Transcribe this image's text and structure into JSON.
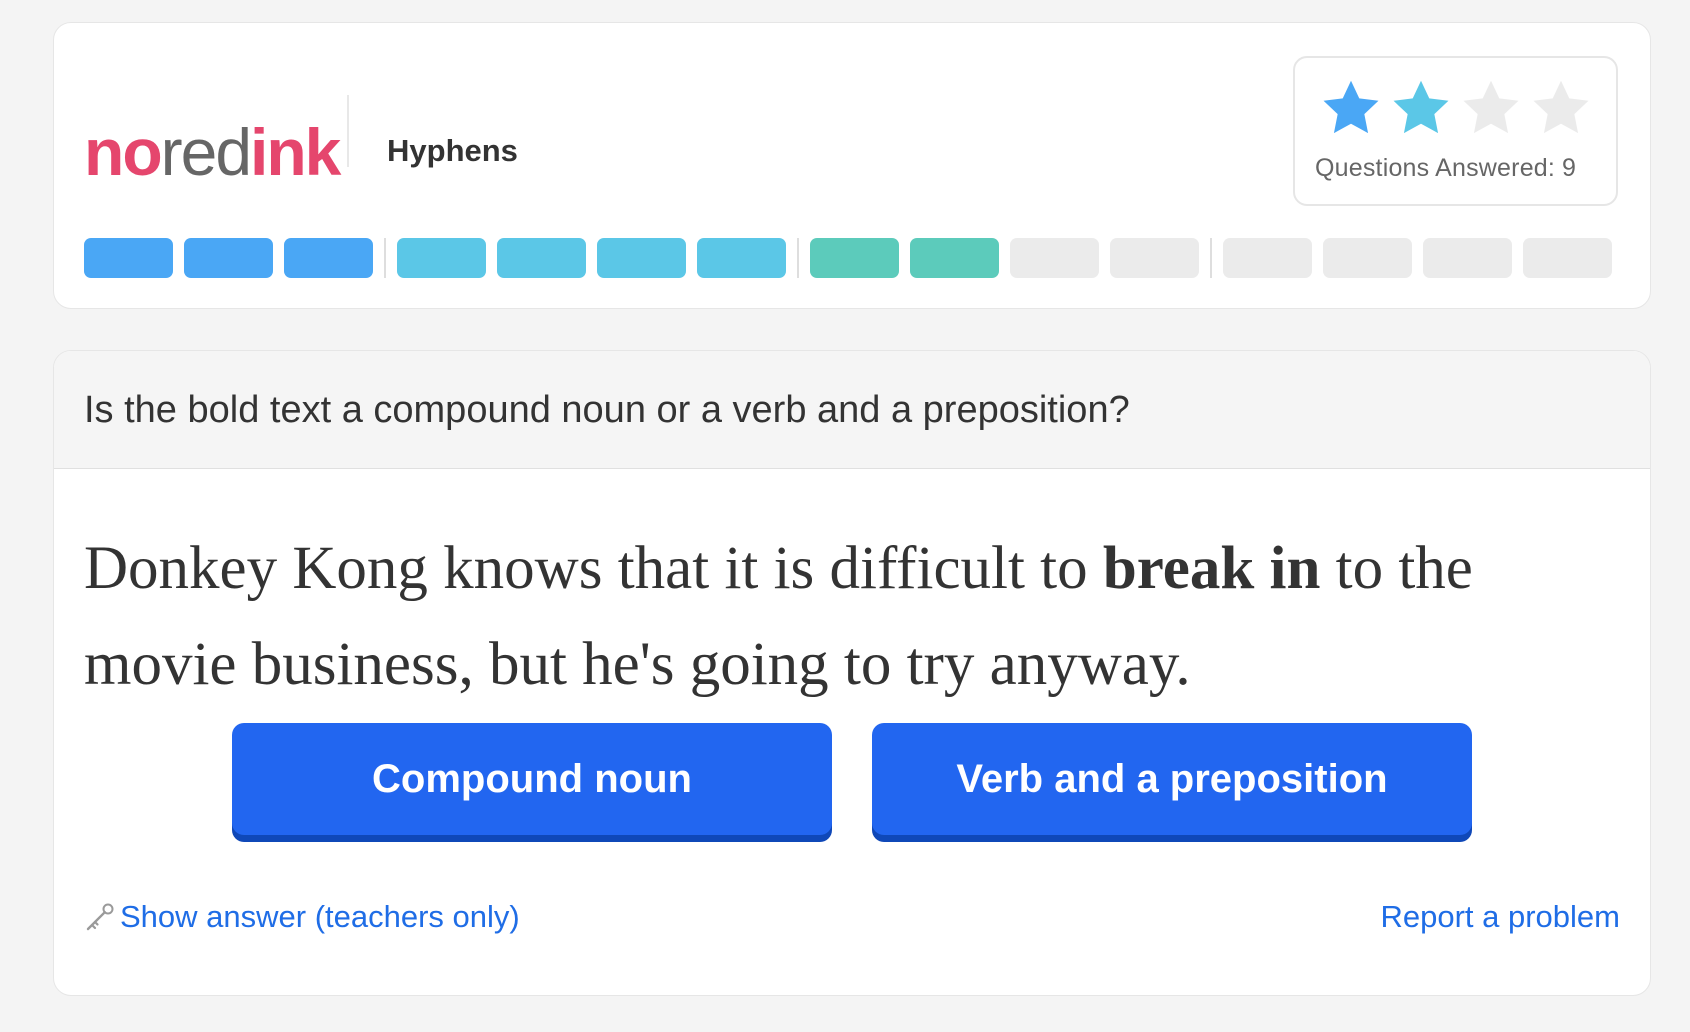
{
  "header": {
    "logo": {
      "part1": "no",
      "part2": "red",
      "part3": "ink"
    },
    "topic": "Hyphens",
    "stars": {
      "total": 4,
      "filled": 2,
      "colors": [
        "#4aa7f5",
        "#5bc7e7",
        "#ebebeb",
        "#ebebeb"
      ]
    },
    "questions_answered_label": "Questions Answered:",
    "questions_answered_value": "9",
    "progress": {
      "groups": [
        [
          "blue",
          "blue",
          "blue"
        ],
        [
          "cyan",
          "cyan",
          "cyan",
          "cyan"
        ],
        [
          "teal",
          "teal",
          "gray",
          "gray"
        ],
        [
          "gray",
          "gray",
          "gray",
          "gray"
        ]
      ]
    }
  },
  "question": {
    "prompt": "Is the bold text a compound noun or a verb and a preposition?",
    "sentence_before": "Donkey Kong knows that it is difficult to ",
    "sentence_bold": "break in",
    "sentence_after": " to the movie business, but he's going to try anyway.",
    "options": [
      "Compound noun",
      "Verb and a preposition"
    ]
  },
  "footer": {
    "show_answer_icon": "key-icon",
    "show_answer": "Show answer (teachers only)",
    "report": "Report a problem"
  },
  "colors": {
    "brand_pink": "#e5466d",
    "button_blue": "#2266f0",
    "link_blue": "#1f6de6"
  }
}
